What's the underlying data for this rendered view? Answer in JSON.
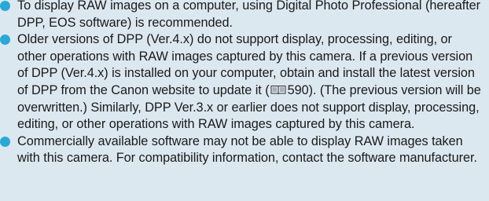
{
  "notes": [
    {
      "text": "To display RAW images on a computer, using Digital Photo Professional (hereafter DPP, EOS software) is recommended."
    },
    {
      "text_before": "Older versions of DPP (Ver.4.x) do not support display, processing, editing, or other operations with RAW images captured by this camera. If a previous version of DPP (Ver.4.x) is installed on your computer, obtain and install the latest version of DPP from the Canon website to update it (",
      "ref_icon": "book-icon",
      "page_ref": "590",
      "text_after": "). (The previous version will be overwritten.) Similarly, DPP Ver.3.x or earlier does not support display, processing, editing, or other operations with RAW images captured by this camera."
    },
    {
      "text": "Commercially available software may not be able to display RAW images taken with this camera. For compatibility information, contact the software manufacturer."
    }
  ],
  "colors": {
    "background": "#dce8f0",
    "bullet": "#2aa9d6",
    "text": "#1a1a1a"
  }
}
